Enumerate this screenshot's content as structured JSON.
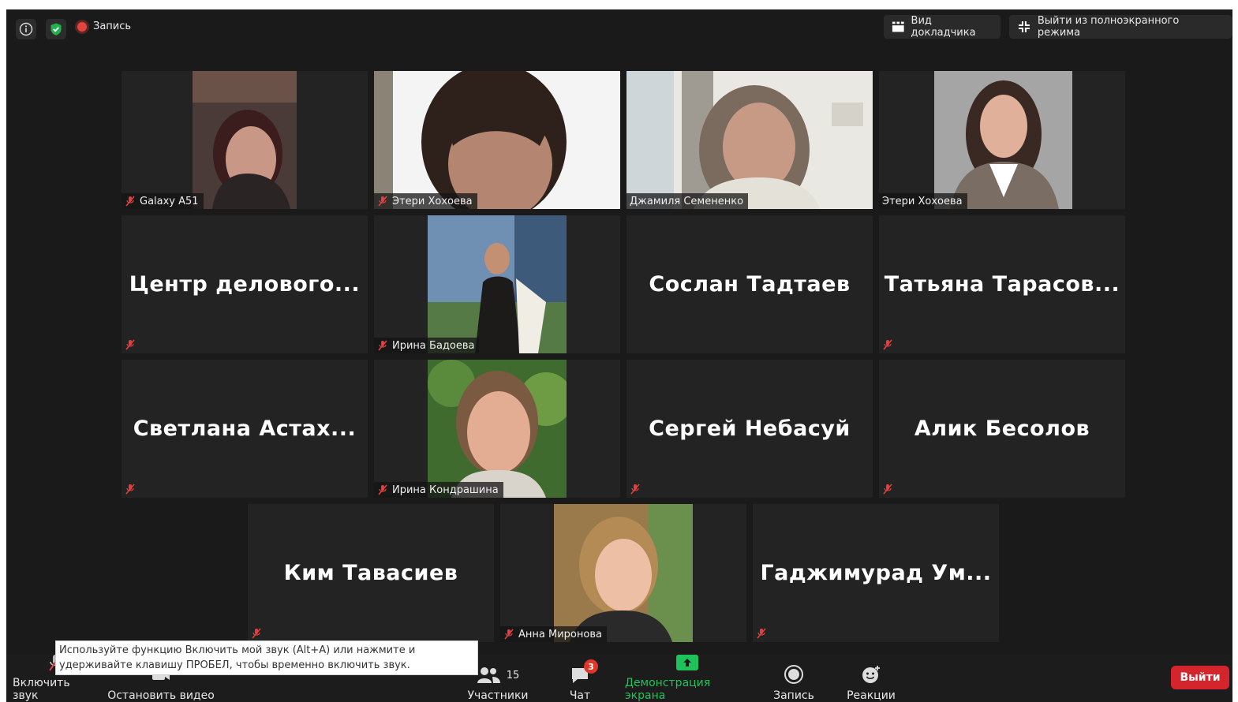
{
  "topbar": {
    "recording_label": "Запись",
    "speaker_view_label": "Вид докладчика",
    "exit_fullscreen_label": "Выйти из полноэкранного режима"
  },
  "tiles": [
    {
      "name": "Galaxy A51",
      "type": "video",
      "muted": true
    },
    {
      "name": "Этери Хохоева",
      "type": "video",
      "muted": true
    },
    {
      "name": "Джамиля Семененко",
      "type": "video",
      "muted": false,
      "active_speaker": true
    },
    {
      "name": "Этери Хохоева",
      "type": "video",
      "muted": false
    },
    {
      "name": "Центр делового...",
      "type": "name",
      "muted": true
    },
    {
      "name": "Ирина Бадоева",
      "type": "video",
      "muted": true
    },
    {
      "name": "Сослан Тадтаев",
      "type": "name",
      "muted": false
    },
    {
      "name": "Татьяна Тарасов...",
      "type": "name",
      "muted": true
    },
    {
      "name": "Светлана Астах...",
      "type": "name",
      "muted": true
    },
    {
      "name": "Ирина Кондрашина",
      "type": "video",
      "muted": true
    },
    {
      "name": "Сергей Небасуй",
      "type": "name",
      "muted": true
    },
    {
      "name": "Алик Бесолов",
      "type": "name",
      "muted": true
    },
    {
      "name": "Ким Тавасиев",
      "type": "name",
      "muted": true
    },
    {
      "name": "Анна Миронова",
      "type": "video",
      "muted": true
    },
    {
      "name": "Гаджимурад Ум...",
      "type": "name",
      "muted": true
    }
  ],
  "tooltip": {
    "text": "Используйте функцию Включить мой звук (Alt+A) или нажмите и удерживайте клавишу ПРОБЕЛ, чтобы временно включить звук."
  },
  "toolbar": {
    "unmute_label": "Включить звук",
    "stop_video_label": "Остановить видео",
    "participants_label": "Участники",
    "participants_count": "15",
    "chat_label": "Чат",
    "chat_badge": "3",
    "share_label": "Демонстрация экрана",
    "record_label": "Запись",
    "reactions_label": "Реакции",
    "leave_label": "Выйти"
  },
  "colors": {
    "background": "#1a1a1a",
    "tile": "#232323",
    "active_speaker_border": "#e3ea71",
    "share_green": "#1fc35c",
    "leave_red": "#d4242c",
    "shield_green": "#23b14d"
  }
}
